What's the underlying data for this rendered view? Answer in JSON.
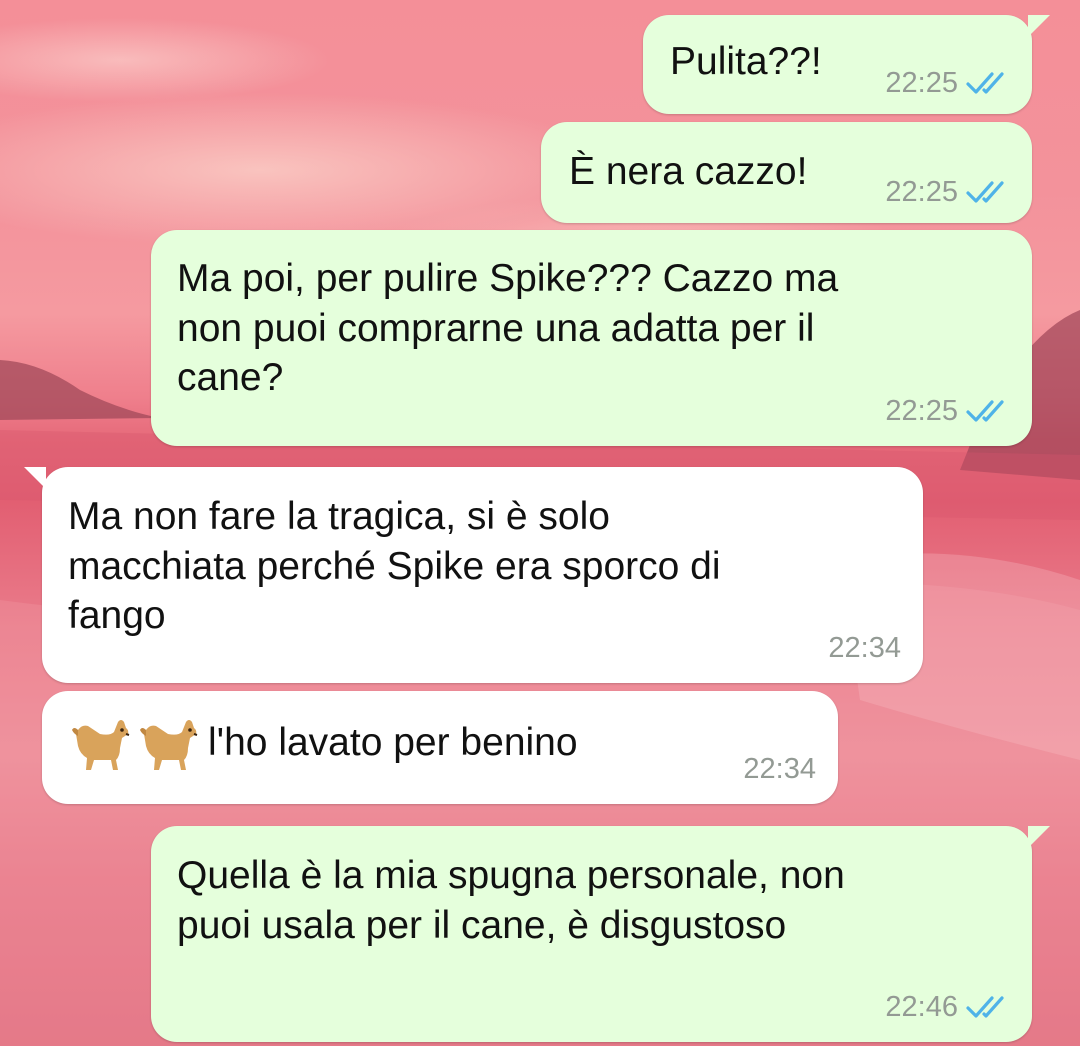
{
  "conversation": {
    "messages": [
      {
        "direction": "outgoing",
        "text": "Pulita??!",
        "time": "22:25",
        "status": "read-ticks-icon"
      },
      {
        "direction": "outgoing",
        "text": "È nera cazzo!",
        "time": "22:25",
        "status": "read-ticks-icon"
      },
      {
        "direction": "outgoing",
        "text": "Ma poi, per pulire Spike??? Cazzo ma\nnon puoi comprarne una adatta per il\ncane?",
        "time": "22:25",
        "status": "read-ticks-icon"
      },
      {
        "direction": "incoming",
        "text": "Ma non fare la tragica, si è solo\nmacchiata perché Spike era sporco di\nfango",
        "time": "22:34"
      },
      {
        "direction": "incoming",
        "text": "l'ho lavato per benino",
        "emoji": [
          "dog-emoji",
          "dog-emoji"
        ],
        "time": "22:34"
      },
      {
        "direction": "outgoing",
        "text": "Quella è la mia spugna personale, non\npuoi usala per il cane, è disgustoso",
        "time": "22:46",
        "status": "read-ticks-icon"
      }
    ]
  },
  "colors": {
    "outgoing_bubble": "#e5ffdc",
    "incoming_bubble": "#ffffff",
    "time_text": "#939a94",
    "read_ticks": "#4fb3e8",
    "wallpaper": "#f08a95"
  }
}
